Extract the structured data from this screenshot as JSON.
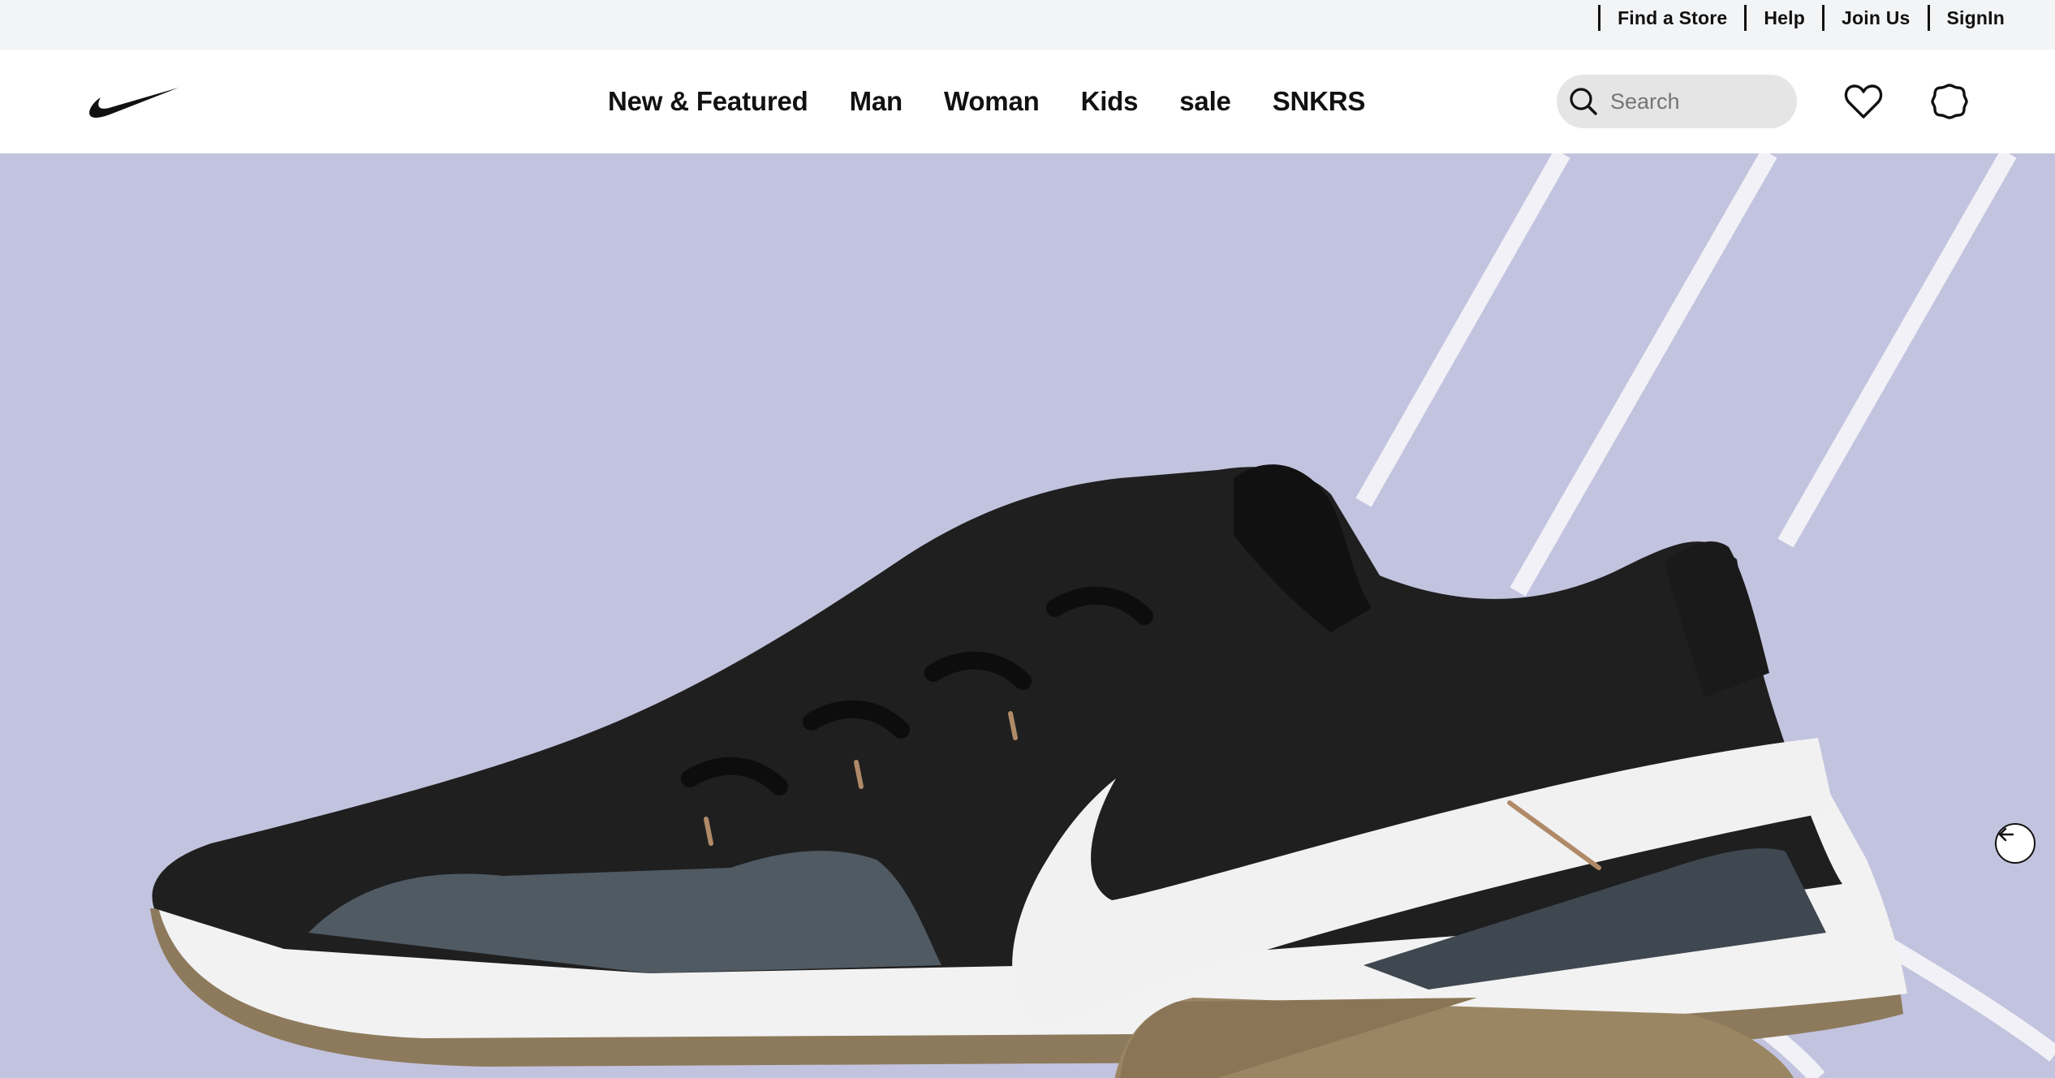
{
  "utility": {
    "links": [
      "Find a Store",
      "Help",
      "Join Us",
      "SignIn"
    ]
  },
  "header": {
    "logo_icon": "swoosh-logo-icon",
    "nav": [
      "New & Featured",
      "Man",
      "Woman",
      "Kids",
      "sale",
      "SNKRS"
    ],
    "search": {
      "placeholder": "Search",
      "value": "",
      "icon": "search-icon"
    },
    "favorites_icon": "heart-icon",
    "bag_icon": "bag-icon"
  },
  "hero": {
    "background_color": "#c2c3de",
    "image": "black-white-training-sneaker",
    "carousel_button_icon": "arrow-left-icon"
  }
}
